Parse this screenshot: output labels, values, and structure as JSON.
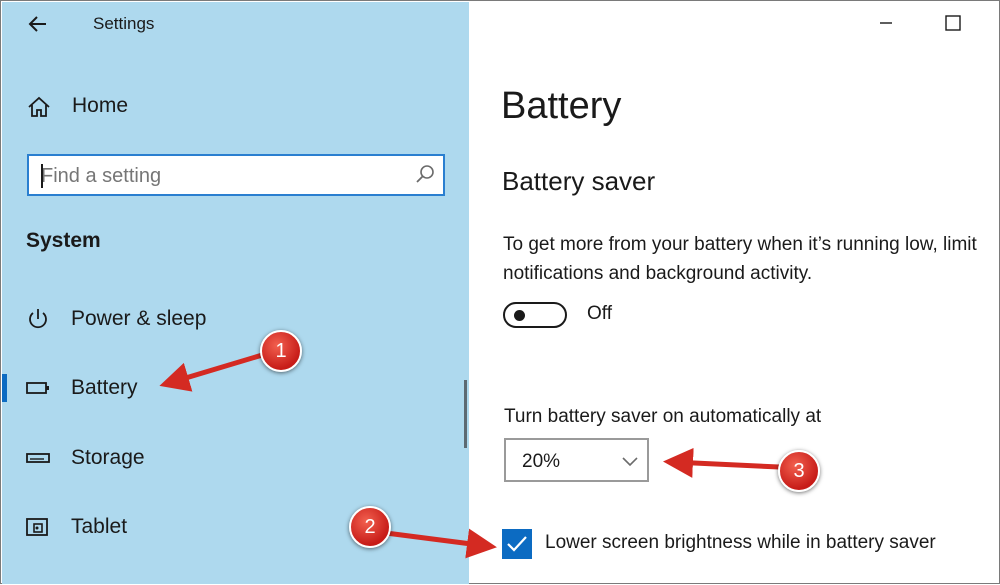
{
  "window": {
    "app_title": "Settings",
    "back_icon": "arrow-left-icon",
    "minimize_icon": "minimize-icon",
    "maximize_icon": "maximize-icon"
  },
  "sidebar": {
    "home_label": "Home",
    "home_icon": "home-icon",
    "search": {
      "placeholder": "Find a setting",
      "value": "",
      "icon": "search-icon"
    },
    "section_title": "System",
    "items": [
      {
        "label": "Power & sleep",
        "icon": "power-icon",
        "selected": false
      },
      {
        "label": "Battery",
        "icon": "battery-icon",
        "selected": true
      },
      {
        "label": "Storage",
        "icon": "storage-icon",
        "selected": false
      },
      {
        "label": "Tablet",
        "icon": "tablet-icon",
        "selected": false
      }
    ],
    "background_color": "#aed9ee",
    "accent_color": "#0c6bc2"
  },
  "main": {
    "page_title": "Battery",
    "section_title": "Battery saver",
    "description": "To get more from your battery when it’s running low, limit notifications and background activity.",
    "toggle": {
      "state": "Off",
      "on": false
    },
    "auto_label": "Turn battery saver on automatically at",
    "threshold": {
      "value": "20%",
      "icon": "chevron-down-icon"
    },
    "brightness_checkbox": {
      "label": "Lower screen brightness while in battery saver",
      "checked": true,
      "icon": "checkmark-icon"
    }
  },
  "annotations": {
    "badges": [
      "1",
      "2",
      "3"
    ],
    "color": "#d42a22"
  }
}
